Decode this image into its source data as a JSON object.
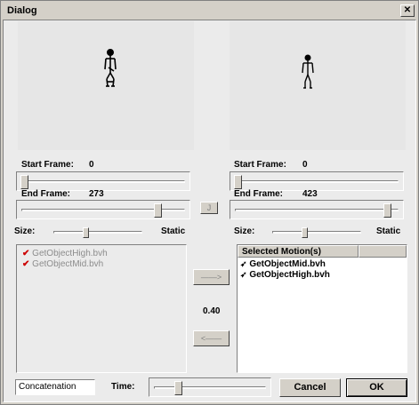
{
  "window": {
    "title": "Dialog",
    "close_glyph": "✕"
  },
  "left_panel": {
    "start_frame_label": "Start Frame:",
    "start_frame_value": "0",
    "end_frame_label": "End Frame:",
    "end_frame_value": "273",
    "size_label": "Size:",
    "static_label": "Static",
    "motions": [
      {
        "label": "GetObjectHigh.bvh",
        "checked": true
      },
      {
        "label": "GetObjectMid.bvh",
        "checked": true
      }
    ],
    "start_frame_slider_level": 0,
    "end_frame_slider_level": 1.0,
    "size_slider_level": 0.35
  },
  "right_panel": {
    "start_frame_label": "Start Frame:",
    "start_frame_value": "0",
    "end_frame_label": "End Frame:",
    "end_frame_value": "423",
    "size_label": "Size:",
    "static_label": "Static",
    "selected_header": "Selected Motion(s)",
    "selected_motions": [
      "GetObjectMid.bvh",
      "GetObjectHigh.bvh"
    ],
    "start_frame_slider_level": 0,
    "end_frame_slider_level": 1.0,
    "size_slider_level": 0.35
  },
  "middle": {
    "j_button_label": "J",
    "add_button_glyph": "——>",
    "remove_button_glyph": "<——",
    "blend_value": "0.40"
  },
  "bottom": {
    "operation_value": "Concatenation",
    "time_label": "Time:",
    "time_slider_level": 0.2,
    "cancel_label": "Cancel",
    "ok_label": "OK"
  },
  "icons": {
    "check": "check-icon",
    "motion": "motion-file-icon"
  }
}
